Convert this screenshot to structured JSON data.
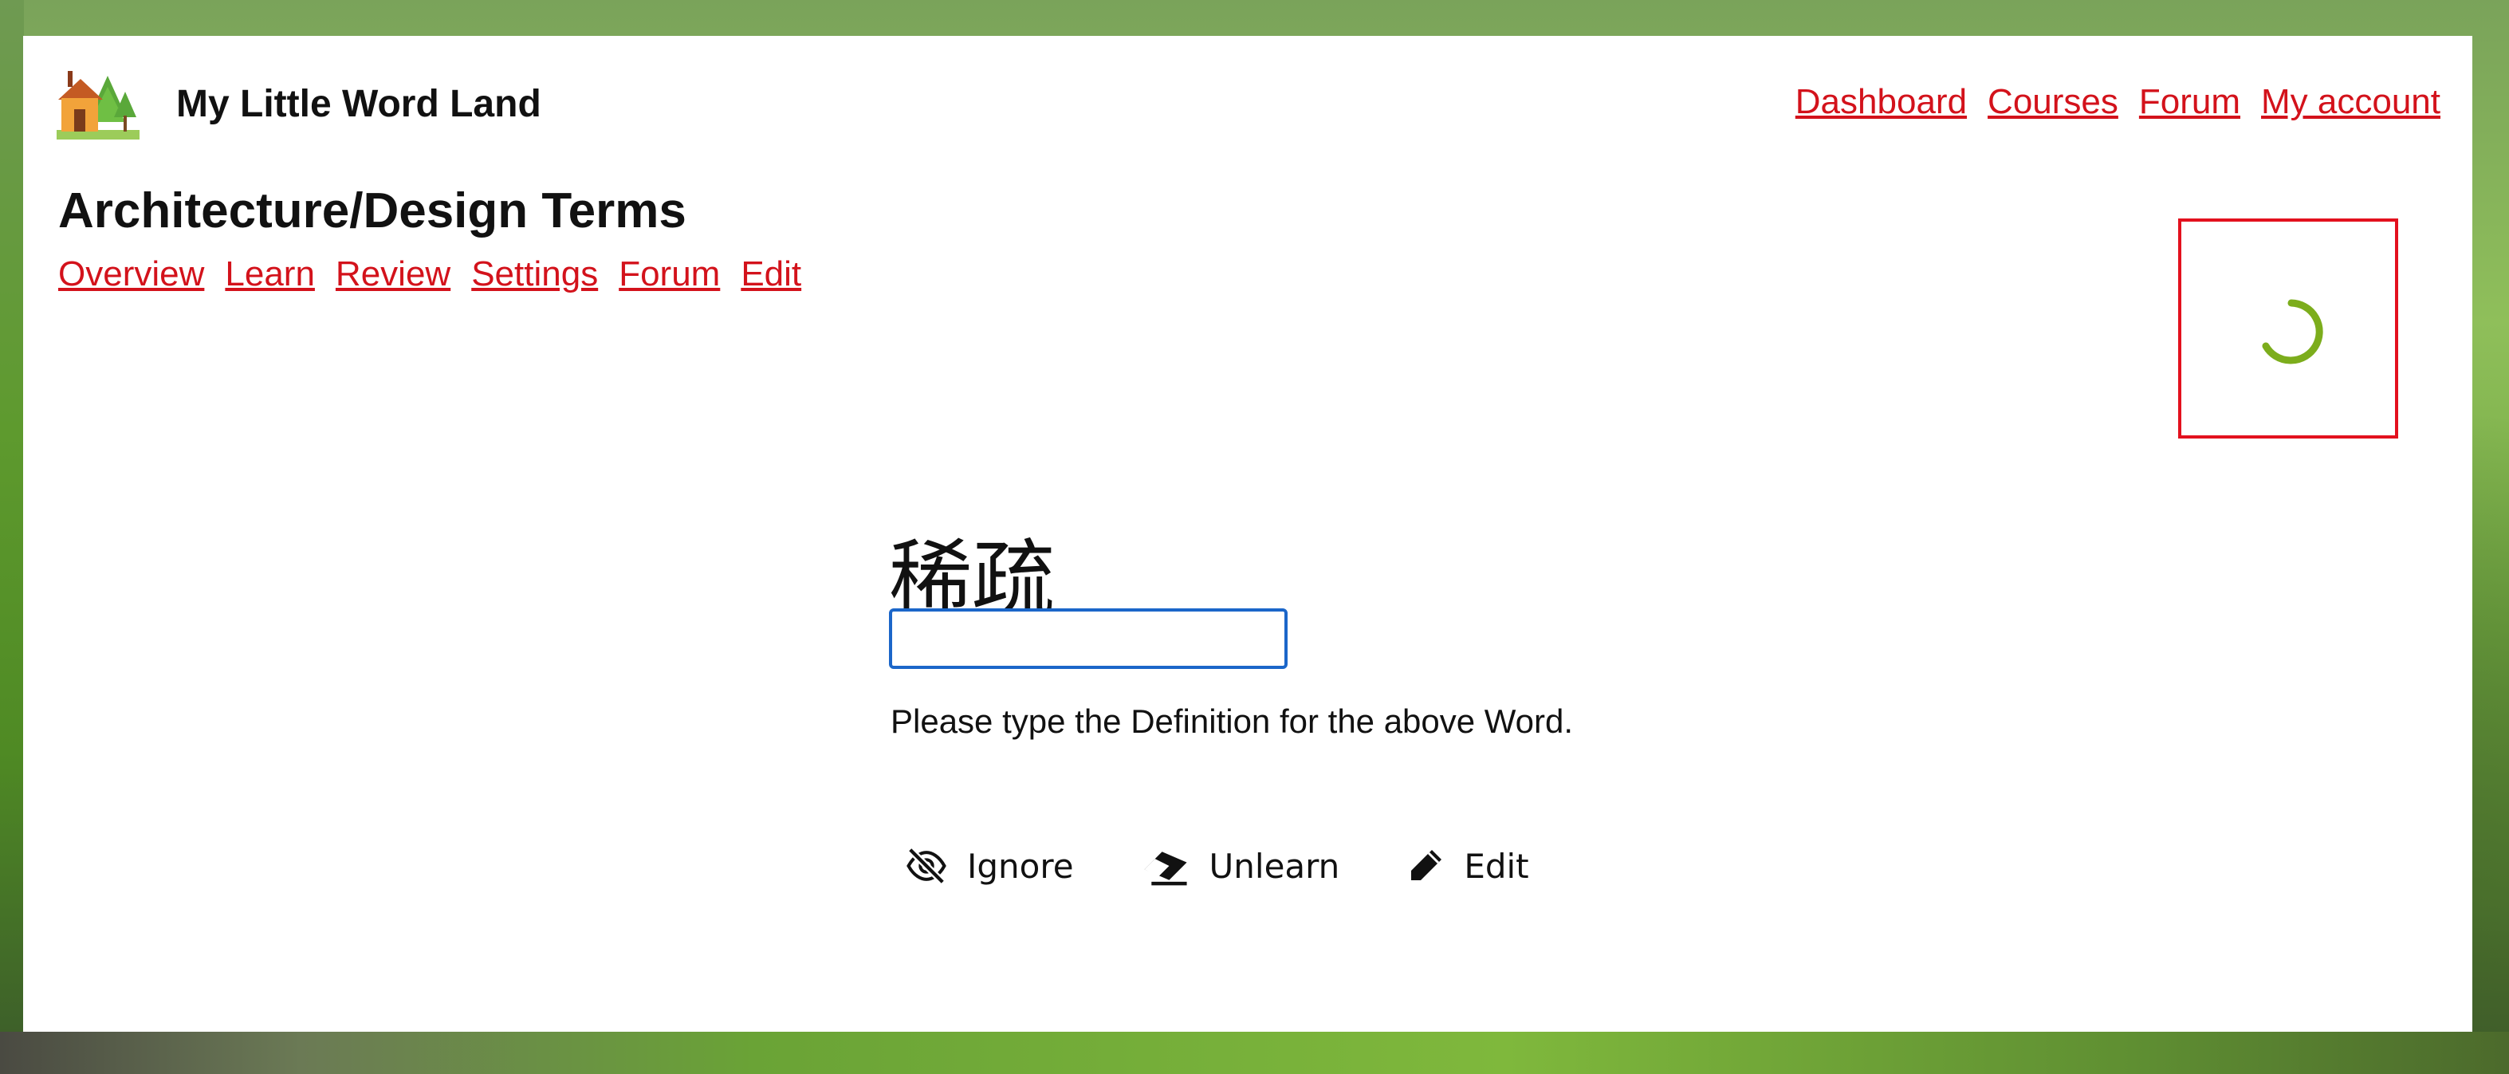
{
  "site": {
    "brand": "My Little Word Land"
  },
  "top_nav": {
    "items": [
      "Dashboard",
      "Courses",
      "Forum",
      "My account"
    ]
  },
  "course": {
    "title": "Architecture/Design Terms",
    "nav": [
      "Overview",
      "Learn",
      "Review",
      "Settings",
      "Forum",
      "Edit"
    ]
  },
  "quiz": {
    "word": "稀疏",
    "answer_value": "",
    "prompt": "Please type the Definition for the above Word."
  },
  "actions": {
    "ignore_label": "Ignore",
    "unlearn_label": "Unlearn",
    "edit_label": "Edit"
  },
  "icons": {
    "logo": "house-with-trees-icon",
    "spinner": "loading-spinner-icon",
    "ignore": "eye-slash-icon",
    "unlearn": "eraser-icon",
    "edit": "pencil-icon"
  },
  "colors": {
    "link": "#d3121b",
    "spinner": "#7cad1c",
    "spinner_border": "#e3111e",
    "input_border": "#1b66c9"
  }
}
